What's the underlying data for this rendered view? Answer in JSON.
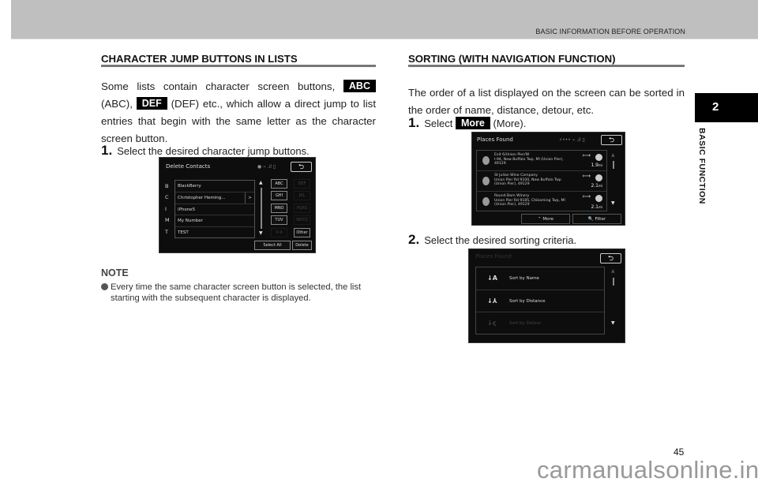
{
  "header": {
    "title": "BASIC INFORMATION BEFORE OPERATION"
  },
  "chapter": {
    "number": "2",
    "label": "BASIC FUNCTION"
  },
  "left": {
    "title": "CHARACTER JUMP BUTTONS IN LISTS",
    "para": {
      "p1": "Some lists contain character screen buttons,",
      "chip1": "ABC",
      "p2": "(ABC),",
      "chip2": "DEF",
      "p3": "(DEF) etc., which allow a direct jump to list entries that begin with the same letter as the character screen button."
    },
    "step1": {
      "num": "1.",
      "text": "Select the desired character jump buttons."
    },
    "screen": {
      "title": "Delete Contacts",
      "back": "⮌",
      "status": "● ⌁ .ıl ▯",
      "rows": [
        {
          "letter": "B",
          "name": "BlackBerry"
        },
        {
          "letter": "C",
          "name": "Christopher Heming...",
          "arrow": ">"
        },
        {
          "letter": "I",
          "name": "iPhone5"
        },
        {
          "letter": "M",
          "name": "My Number"
        },
        {
          "letter": "T",
          "name": "TEST"
        }
      ],
      "keys": [
        {
          "label": "ABC",
          "enabled": true
        },
        {
          "label": "DEF",
          "enabled": false
        },
        {
          "label": "GHI",
          "enabled": true
        },
        {
          "label": "JKL",
          "enabled": false
        },
        {
          "label": "MNO",
          "enabled": true
        },
        {
          "label": "PQRS",
          "enabled": false
        },
        {
          "label": "TUV",
          "enabled": true
        },
        {
          "label": "WXYZ",
          "enabled": false
        },
        {
          "label": "0-9",
          "enabled": false
        },
        {
          "label": "Other",
          "enabled": true
        }
      ],
      "select_all": "Select All",
      "delete": "Delete"
    },
    "note": {
      "title": "NOTE",
      "text": "Every time the same character screen button is selected, the list starting with the subsequent character is displayed."
    }
  },
  "right": {
    "title": "SORTING (WITH NAVIGATION FUNCTION)",
    "para": "The order of a list displayed on the screen can be sorted in the order of name, distance, detour, etc.",
    "step1": {
      "num": "1.",
      "pre": "Select",
      "chip": "More",
      "post": "(More)."
    },
    "places_screen": {
      "title": "Places Found",
      "back": "⮌",
      "status": "⚡••• ⌁ .ıl ▯",
      "rows": [
        {
          "name": "Exit 6/Union Pier/W",
          "line2": "I-94, New Buffalo Twp, MI (Union Pier),",
          "line3": "49129",
          "distance": "1.9",
          "unit": "mi"
        },
        {
          "name": "St Julian Wine Company",
          "line2": "Union Pier Rd 9100, New Buffalo Twp",
          "line3": "(Union Pier), 49129",
          "distance": "2.1",
          "unit": "mi"
        },
        {
          "name": "Round Barn Winery",
          "line2": "Union Pier Rd 9185, Chikaming Twp, MI",
          "line3": "(Union Pier), 49129",
          "distance": "2.1",
          "unit": "mi"
        }
      ],
      "more": "⌃ More",
      "filter": "🔍 Filter"
    },
    "step2": {
      "num": "2.",
      "text": "Select the desired sorting criteria."
    },
    "sort_screen": {
      "title": "Places Found",
      "back": "⮌",
      "options": [
        {
          "icon": "↓A",
          "label": "Sort by Name"
        },
        {
          "icon": "↓⅄",
          "label": "Sort by Distance"
        },
        {
          "icon": "↓ς",
          "label": "Sort by Detour"
        }
      ]
    }
  },
  "footer": {
    "page": "45",
    "watermark": "carmanualsonline.info"
  }
}
